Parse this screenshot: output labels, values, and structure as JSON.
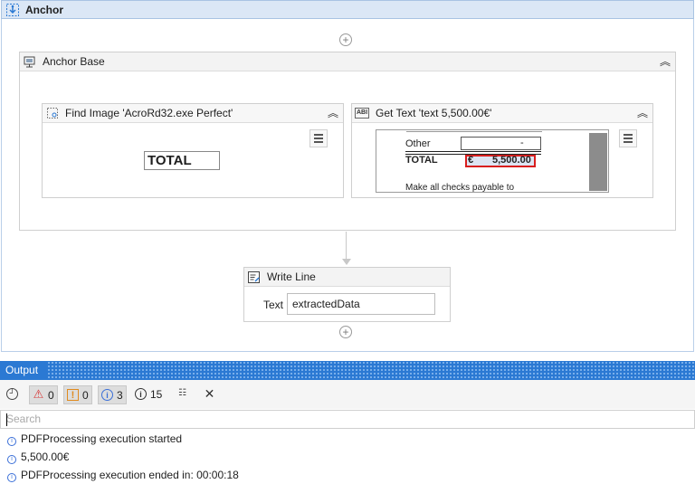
{
  "anchor": {
    "title": "Anchor"
  },
  "anchor_base": {
    "title": "Anchor Base"
  },
  "find_image": {
    "title": "Find Image 'AcroRd32.exe Perfect'",
    "preview_text": "TOTAL"
  },
  "get_text": {
    "title": "Get Text 'text  5,500.00€'",
    "preview": {
      "row_other_label": "Other",
      "row_other_value": "-",
      "row_total_label": "TOTAL",
      "currency": "€",
      "amount": "5,500.00",
      "footer": "Make all checks payable to"
    }
  },
  "write_line": {
    "title": "Write Line",
    "text_label": "Text",
    "text_value": "extractedData"
  },
  "output": {
    "title": "Output",
    "filters": [
      {
        "name": "errors",
        "count": "0",
        "color": "#d83b3b"
      },
      {
        "name": "warnings",
        "count": "0",
        "color": "#e08a1e"
      },
      {
        "name": "info",
        "count": "3",
        "color": "#3a6fd8"
      },
      {
        "name": "trace",
        "count": "15",
        "color": "#333333"
      }
    ],
    "search_placeholder": "Search",
    "logs": [
      "PDFProcessing execution started",
      "5,500.00€",
      "PDFProcessing execution ended in: 00:00:18"
    ]
  }
}
